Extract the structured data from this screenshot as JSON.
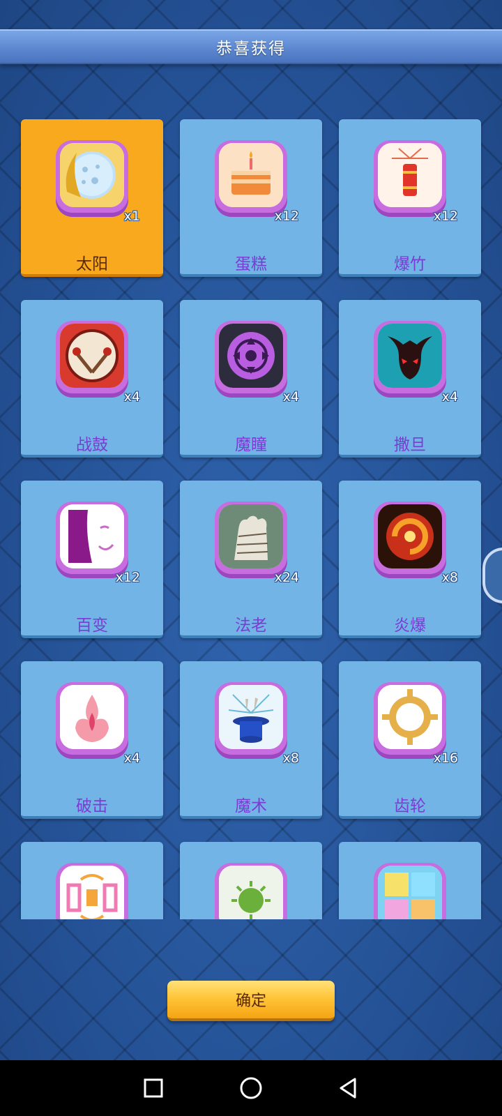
{
  "header": {
    "title": "恭喜获得"
  },
  "items": [
    {
      "name": "太阳",
      "count": "x1",
      "icon": "moon-icon",
      "featured": true
    },
    {
      "name": "蛋糕",
      "count": "x12",
      "icon": "cake-icon",
      "featured": false
    },
    {
      "name": "爆竹",
      "count": "x12",
      "icon": "firecracker-icon",
      "featured": false
    },
    {
      "name": "战鼓",
      "count": "x4",
      "icon": "war-drum-icon",
      "featured": false
    },
    {
      "name": "魔瞳",
      "count": "x4",
      "icon": "magic-eye-icon",
      "featured": false
    },
    {
      "name": "撒旦",
      "count": "x4",
      "icon": "demon-mask-icon",
      "featured": false
    },
    {
      "name": "百变",
      "count": "x12",
      "icon": "theater-mask-icon",
      "featured": false
    },
    {
      "name": "法老",
      "count": "x24",
      "icon": "mummy-hand-icon",
      "featured": false
    },
    {
      "name": "炎爆",
      "count": "x8",
      "icon": "fire-vortex-icon",
      "featured": false
    },
    {
      "name": "破击",
      "count": "x4",
      "icon": "flame-icon",
      "featured": false
    },
    {
      "name": "魔术",
      "count": "x8",
      "icon": "magic-hat-icon",
      "featured": false
    },
    {
      "name": "齿轮",
      "count": "x16",
      "icon": "gear-icon",
      "featured": false
    },
    {
      "name": "",
      "count": "",
      "icon": "swap-arrows-icon",
      "featured": false
    },
    {
      "name": "",
      "count": "",
      "icon": "virus-icon",
      "featured": false
    },
    {
      "name": "",
      "count": "",
      "icon": "puzzle-icon",
      "featured": false
    }
  ],
  "confirm_button": {
    "label": "确定"
  },
  "navbar": {
    "icons": [
      "recent-apps-icon",
      "home-icon",
      "back-icon"
    ]
  }
}
